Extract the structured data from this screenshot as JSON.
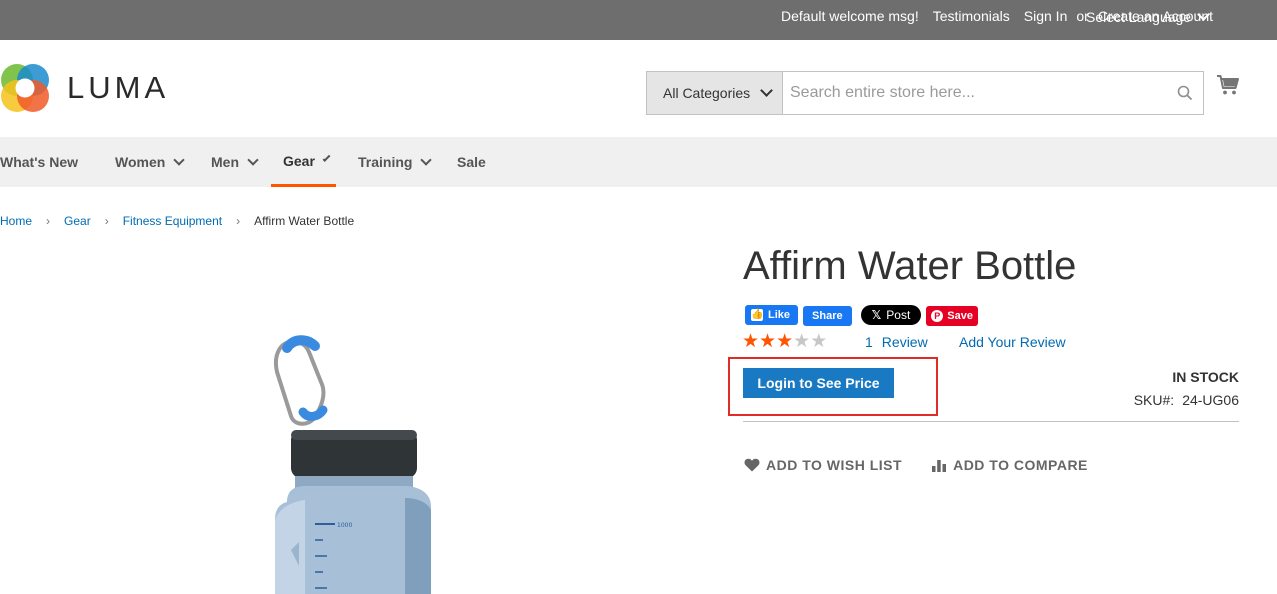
{
  "topbar": {
    "welcome": "Default welcome msg!",
    "testimonials": "Testimonials",
    "sign_in": "Sign In",
    "or": "or",
    "create_account": "Create an Account",
    "language": "Select Language"
  },
  "header": {
    "logo_text": "LUMA",
    "search": {
      "category": "All Categories",
      "placeholder": "Search entire store here..."
    }
  },
  "nav": {
    "items": [
      {
        "label": "What's New"
      },
      {
        "label": "Women"
      },
      {
        "label": "Men"
      },
      {
        "label": "Gear"
      },
      {
        "label": "Training"
      },
      {
        "label": "Sale"
      }
    ]
  },
  "breadcrumb": {
    "items": [
      "Home",
      "Gear",
      "Fitness Equipment"
    ],
    "current": "Affirm Water Bottle"
  },
  "product": {
    "title": "Affirm Water Bottle",
    "social": {
      "like": "Like",
      "share": "Share",
      "post": "Post",
      "save": "Save"
    },
    "rating": {
      "stars_filled": 3,
      "stars_total": 5,
      "review_count": "1",
      "review_label": "Review",
      "add_review": "Add Your Review"
    },
    "login_price": "Login to See Price",
    "stock": "IN STOCK",
    "sku_label": "SKU#:",
    "sku": "24-UG06",
    "actions": {
      "wishlist": "ADD TO WISH LIST",
      "compare": "ADD TO COMPARE"
    }
  },
  "colors": {
    "link": "#006bb4",
    "primary_button": "#1979c3",
    "accent": "#ff5501",
    "highlight_box": "#e02b27"
  },
  "icons": [
    "chevron-down-icon",
    "search-icon",
    "cart-icon",
    "heart-icon",
    "compare-icon",
    "star-icon"
  ]
}
